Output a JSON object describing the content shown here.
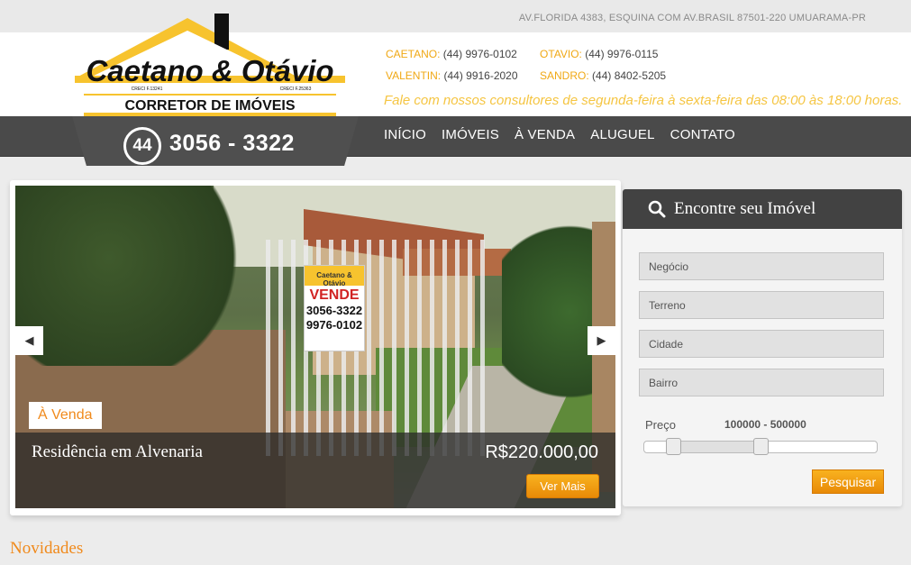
{
  "header": {
    "address": "AV.FLORIDA 4383, ESQUINA COM AV.BRASIL 87501-220 UMUARAMA-PR",
    "logo": {
      "name": "Caetano & Otávio",
      "creci_left": "CRECI F.13241",
      "creci_right": "CRECI F.25363",
      "tagline": "CORRETOR DE IMÓVEIS"
    },
    "phone": {
      "ddd": "44",
      "number": "3056 - 3322"
    },
    "contacts": [
      {
        "name": "CAETANO:",
        "phone": "(44) 9976-0102"
      },
      {
        "name": "OTAVIO:",
        "phone": "(44) 9976-0115"
      },
      {
        "name": "VALENTIN:",
        "phone": "(44) 9916-2020"
      },
      {
        "name": "SANDRO:",
        "phone": "(44) 8402-5205"
      }
    ],
    "hours": "Fale com nossos consultores de segunda-feira à sexta-feira das 08:00 às 18:00 horas."
  },
  "nav": [
    "INÍCIO",
    "IMÓVEIS",
    "À VENDA",
    "ALUGUEL",
    "CONTATO"
  ],
  "slider": {
    "badge": "À Venda",
    "title": "Residência em Alvenaria",
    "price": "R$220.000,00",
    "button": "Ver Mais",
    "prev_arrow": "◀",
    "next_arrow": "▶",
    "sign": {
      "brand": "Caetano & Otávio",
      "word": "VENDE",
      "line1": "3056-3322",
      "line2": "9976-0102"
    }
  },
  "search": {
    "title": "Encontre seu Imóvel",
    "icon": "search-icon",
    "fields": [
      "Negócio",
      "Terreno",
      "Cidade",
      "Bairro"
    ],
    "price_label": "Preço",
    "price_range": "100000 - 500000",
    "price_min_fraction": 0.1,
    "price_max_fraction": 0.5,
    "button": "Pesquisar"
  },
  "section_title": "Novidades",
  "colors": {
    "accent": "#f0a814",
    "orange": "#f08a1c",
    "dark": "#4a4a4a",
    "logo_yellow": "#f7c32e"
  }
}
